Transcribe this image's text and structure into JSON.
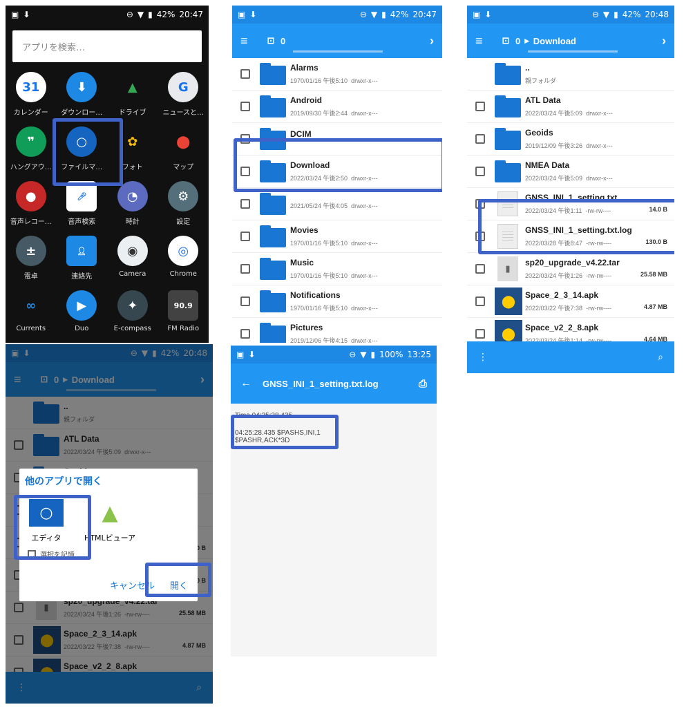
{
  "status": {
    "p1": {
      "battery": "42%",
      "time": "20:47"
    },
    "p2": {
      "battery": "42%",
      "time": "20:47"
    },
    "p3": {
      "battery": "42%",
      "time": "20:48"
    },
    "p4": {
      "battery": "42%",
      "time": "20:48"
    },
    "p5": {
      "battery": "100%",
      "time": "13:25"
    }
  },
  "launcher": {
    "search_placeholder": "アプリを検索…",
    "apps": [
      {
        "label": "カレンダー",
        "glyph": "31",
        "color": "#ffffff",
        "fg": "#1a73e8"
      },
      {
        "label": "ダウンロー…",
        "glyph": "⬇",
        "color": "#1e88e5",
        "fg": "#fff"
      },
      {
        "label": "ドライブ",
        "glyph": "▲",
        "color": "#111",
        "fg": "#34a853"
      },
      {
        "label": "ニュースと…",
        "glyph": "G",
        "color": "#e8eaed",
        "fg": "#1a73e8"
      },
      {
        "label": "ハングアウ…",
        "glyph": "❞",
        "color": "#0f9d58",
        "fg": "#fff"
      },
      {
        "label": "ファイルマ…",
        "glyph": "○",
        "color": "#1565c0",
        "fg": "#fff"
      },
      {
        "label": "フォト",
        "glyph": "✿",
        "color": "#111",
        "fg": "#fbbc05"
      },
      {
        "label": "マップ",
        "glyph": "⬤",
        "color": "#111",
        "fg": "#ea4335"
      },
      {
        "label": "音声レコー…",
        "glyph": "●",
        "color": "#c62828",
        "fg": "#fff"
      },
      {
        "label": "音声検索",
        "glyph": "🎤︎",
        "color": "#fff",
        "fg": "#1a73e8"
      },
      {
        "label": "時計",
        "glyph": "◔",
        "color": "#5c6bc0",
        "fg": "#fff"
      },
      {
        "label": "設定",
        "glyph": "⚙",
        "color": "#546e7a",
        "fg": "#fff"
      },
      {
        "label": "電卓",
        "glyph": "±",
        "color": "#455a64",
        "fg": "#fff"
      },
      {
        "label": "連絡先",
        "glyph": "👤︎",
        "color": "#1e88e5",
        "fg": "#fff"
      },
      {
        "label": "Camera",
        "glyph": "◉",
        "color": "#eceff1",
        "fg": "#333"
      },
      {
        "label": "Chrome",
        "glyph": "◎",
        "color": "#fff",
        "fg": "#1a73e8"
      },
      {
        "label": "Currents",
        "glyph": "∞",
        "color": "#111",
        "fg": "#1e88e5"
      },
      {
        "label": "Duo",
        "glyph": "▶",
        "color": "#1e88e5",
        "fg": "#fff"
      },
      {
        "label": "E-compass",
        "glyph": "✦",
        "color": "#37474f",
        "fg": "#fff"
      },
      {
        "label": "FM Radio",
        "glyph": "90.9",
        "color": "#424242",
        "fg": "#fff"
      }
    ]
  },
  "root": {
    "path": "0",
    "items": [
      {
        "name": "Alarms",
        "date": "1970/01/16 午後5:10",
        "perm": "drwxr-x---"
      },
      {
        "name": "Android",
        "date": "2019/09/30 午後2:44",
        "perm": "drwxr-x---"
      },
      {
        "name": "DCIM",
        "date": "",
        "perm": ""
      },
      {
        "name": "Download",
        "date": "2022/03/24 午後2:50",
        "perm": "drwxr-x---"
      },
      {
        "name": "",
        "date": "2021/05/24 午後4:05",
        "perm": "drwxr-x---"
      },
      {
        "name": "Movies",
        "date": "1970/01/16 午後5:10",
        "perm": "drwxr-x---"
      },
      {
        "name": "Music",
        "date": "1970/01/16 午後5:10",
        "perm": "drwxr-x---"
      },
      {
        "name": "Notifications",
        "date": "1970/01/16 午後5:10",
        "perm": "drwxr-x---"
      },
      {
        "name": "Pictures",
        "date": "2019/12/06 午後4:15",
        "perm": "drwxr-x---"
      }
    ]
  },
  "download": {
    "path_root": "0",
    "path_current": "Download",
    "parent": {
      "name": "..",
      "label": "親フォルダ"
    },
    "items": [
      {
        "kind": "folder",
        "name": "ATL Data",
        "date": "2022/03/24 午後5:09",
        "perm": "drwxr-x---",
        "size": ""
      },
      {
        "kind": "folder",
        "name": "Geoids",
        "date": "2019/12/09 午後3:26",
        "perm": "drwxr-x---",
        "size": ""
      },
      {
        "kind": "folder",
        "name": "NMEA Data",
        "date": "2022/03/24 午後5:09",
        "perm": "drwxr-x---",
        "size": ""
      },
      {
        "kind": "doc",
        "name": "GNSS_INI_1_setting.txt",
        "date": "2022/03/24 午後1:11",
        "perm": "-rw-rw----",
        "size": "14.0 B"
      },
      {
        "kind": "doc",
        "name": "GNSS_INI_1_setting.txt.log",
        "date": "2022/03/28 午後8:47",
        "perm": "-rw-rw----",
        "size": "130.0 B"
      },
      {
        "kind": "tar",
        "name": "sp20_upgrade_v4.22.tar",
        "date": "2022/03/24 午後1:26",
        "perm": "-rw-rw----",
        "size": "25.58 MB"
      },
      {
        "kind": "apk",
        "name": "Space_2_3_14.apk",
        "date": "2022/03/22 午後7:38",
        "perm": "-rw-rw----",
        "size": "4.87 MB"
      },
      {
        "kind": "apk",
        "name": "Space_v2_2_8.apk",
        "date": "2022/03/24 午後1:14",
        "perm": "-rw-rw----",
        "size": "4.64 MB"
      }
    ]
  },
  "dialog": {
    "title": "他のアプリで開く",
    "apps": [
      {
        "label": "エディタ"
      },
      {
        "label": "HTMLビューア"
      }
    ],
    "remember": "選択を記憶",
    "cancel": "キャンセル",
    "open": "開く"
  },
  "viewer": {
    "title": "GNSS_INI_1_setting.txt.log",
    "time_line": "Time 04:25:28.435",
    "line1": "04:25:28.435 $PASHS,INI,1",
    "line2": "$PASHR,ACK*3D"
  }
}
